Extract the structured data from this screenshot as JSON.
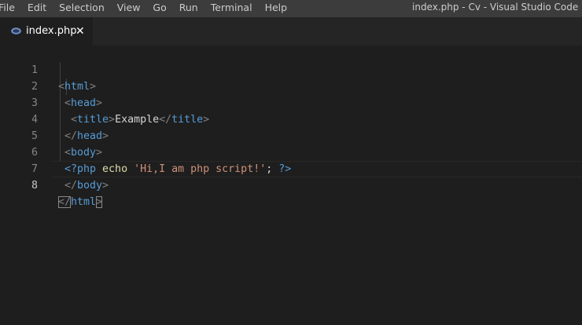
{
  "menu": {
    "items": [
      "File",
      "Edit",
      "Selection",
      "View",
      "Go",
      "Run",
      "Terminal",
      "Help"
    ]
  },
  "window": {
    "title": "index.php - Cv - Visual Studio Code"
  },
  "tab": {
    "label": "index.php",
    "close": "✕",
    "icon": "php-file-icon"
  },
  "editor": {
    "line_numbers": [
      "1",
      "2",
      "3",
      "4",
      "5",
      "6",
      "7",
      "8"
    ],
    "active_line": 8,
    "tokens": {
      "l1_lt": "<",
      "l1_tag": "html",
      "l1_gt": ">",
      "l2_lt": "<",
      "l2_tag": "head",
      "l2_gt": ">",
      "l3_lt": "<",
      "l3_tag": "title",
      "l3_gt": ">",
      "l3_text": "Example",
      "l3_lt2": "</",
      "l3_tag2": "title",
      "l3_gt2": ">",
      "l4_lt": "</",
      "l4_tag": "head",
      "l4_gt": ">",
      "l5_lt": "<",
      "l5_tag": "body",
      "l5_gt": ">",
      "l6_open": "<?php",
      "l6_echo": "echo",
      "l6_str": "'Hi,I am php script!'",
      "l6_semi": ";",
      "l6_close": "?>",
      "l7_lt": "</",
      "l7_tag": "body",
      "l7_gt": ">",
      "l8_lt": "</",
      "l8_tag": "html",
      "l8_gt": ">"
    }
  },
  "colors": {
    "titlebar": "#3c3c3c",
    "tabbar": "#252526",
    "editor_bg": "#1e1e1e",
    "tag": "#569cd6",
    "string": "#ce9178",
    "text": "#d4d4d4",
    "bracket": "#808080"
  }
}
